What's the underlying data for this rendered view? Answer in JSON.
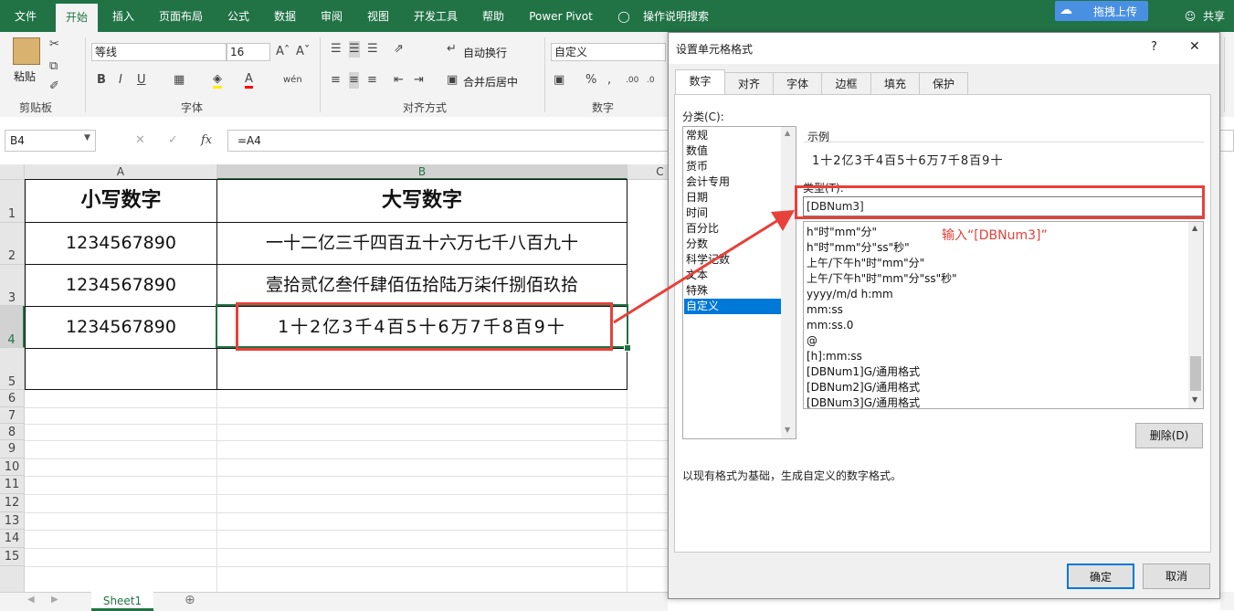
{
  "ribbon": {
    "tabs": [
      "文件",
      "开始",
      "插入",
      "页面布局",
      "公式",
      "数据",
      "审阅",
      "视图",
      "开发工具",
      "帮助",
      "Power Pivot",
      "操作说明搜索"
    ],
    "active_tab": "开始",
    "upload_label": "拖拽上传",
    "share_label": "共享",
    "paste_label": "粘贴",
    "font_name": "等线",
    "font_size": "16",
    "wrap_text": "自动换行",
    "merge_center": "合并后居中",
    "number_format": "自定义",
    "groups": {
      "clipboard": "剪贴板",
      "font": "字体",
      "alignment": "对齐方式",
      "number": "数字"
    }
  },
  "formula_bar": {
    "name_box": "B4",
    "formula": "=A4"
  },
  "sheet": {
    "columns": [
      "A",
      "B",
      "C"
    ],
    "rows": [
      "1",
      "2",
      "3",
      "4",
      "5",
      "6",
      "7",
      "8",
      "9",
      "10",
      "11",
      "12",
      "13",
      "14",
      "15"
    ],
    "cells": {
      "a1": "小写数字",
      "b1": "大写数字",
      "a2": "1234567890",
      "b2": "一十二亿三千四百五十六万七千八百九十",
      "a3": "1234567890",
      "b3": "壹拾贰亿叁仟肆佰伍拾陆万柒仟捌佰玖拾",
      "a4": "1234567890",
      "b4": "1十2亿3千4百5十6万7千8百9十"
    },
    "tab_name": "Sheet1"
  },
  "dialog": {
    "title": "设置单元格格式",
    "help": "?",
    "close": "✕",
    "tabs": [
      "数字",
      "对齐",
      "字体",
      "边框",
      "填充",
      "保护"
    ],
    "category_label": "分类(C):",
    "categories": [
      "常规",
      "数值",
      "货币",
      "会计专用",
      "日期",
      "时间",
      "百分比",
      "分数",
      "科学记数",
      "文本",
      "特殊",
      "自定义"
    ],
    "selected_category": "自定义",
    "sample_label": "示例",
    "sample_value": "1十2亿3千4百5十6万7千8百9十",
    "type_label": "类型(T):",
    "type_value": "[DBNum3]",
    "type_list": [
      "h\"时\"mm\"分\"",
      "h\"时\"mm\"分\"ss\"秒\"",
      "上午/下午h\"时\"mm\"分\"",
      "上午/下午h\"时\"mm\"分\"ss\"秒\"",
      "yyyy/m/d h:mm",
      "mm:ss",
      "mm:ss.0",
      "@",
      "[h]:mm:ss",
      "[DBNum1]G/通用格式",
      "[DBNum2]G/通用格式",
      "[DBNum3]G/通用格式"
    ],
    "delete_label": "删除(D)",
    "description": "以现有格式为基础，生成自定义的数字格式。",
    "ok_label": "确定",
    "cancel_label": "取消"
  },
  "annotation": {
    "text": "输入“[DBNum3]”",
    "color": "#e8403a"
  }
}
